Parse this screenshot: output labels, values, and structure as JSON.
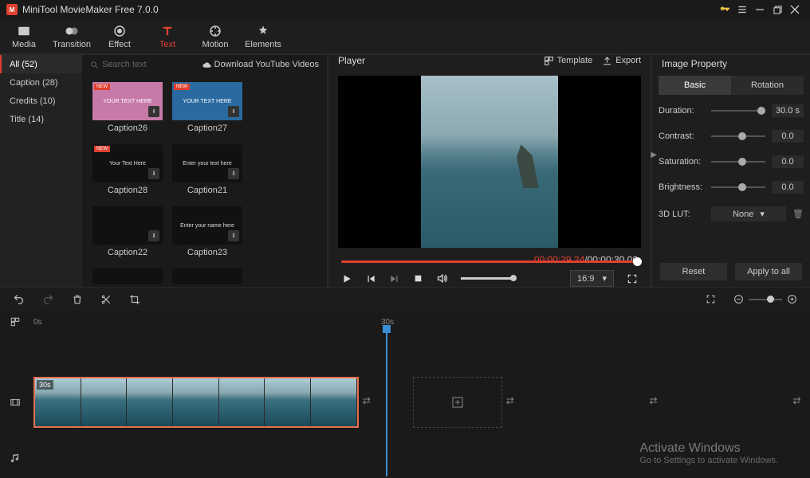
{
  "titlebar": {
    "title": "MiniTool MovieMaker Free 7.0.0"
  },
  "maintabs": {
    "media": "Media",
    "transition": "Transition",
    "effect": "Effect",
    "text": "Text",
    "motion": "Motion",
    "elements": "Elements"
  },
  "categories": [
    {
      "label": "All (52)",
      "active": true
    },
    {
      "label": "Caption (28)",
      "active": false
    },
    {
      "label": "Credits (10)",
      "active": false
    },
    {
      "label": "Title (14)",
      "active": false
    }
  ],
  "search_placeholder": "Search text",
  "download_link": "Download YouTube Videos",
  "captions": [
    {
      "name": "Caption26",
      "new": true,
      "inner": "YOUR TEXT HERE",
      "bg": "#c77aa8"
    },
    {
      "name": "Caption27",
      "new": true,
      "inner": "YOUR TEXT HERE",
      "bg": "#2a6aa0"
    },
    {
      "name": "Caption28",
      "new": true,
      "inner": "Your Text Here",
      "bg": "#111"
    },
    {
      "name": "Caption21",
      "new": false,
      "inner": "Enter your text here",
      "bg": "#111"
    },
    {
      "name": "Caption22",
      "new": false,
      "inner": "",
      "bg": "#111"
    },
    {
      "name": "Caption23",
      "new": false,
      "inner": "Enter your name here",
      "bg": "#111"
    }
  ],
  "player": {
    "title": "Player",
    "template": "Template",
    "export": "Export",
    "current": "00:00:29.24",
    "sep": " / ",
    "total": "00:00:30.00",
    "aspect": "16:9"
  },
  "props": {
    "title": "Image Property",
    "tabs": {
      "basic": "Basic",
      "rotation": "Rotation"
    },
    "duration": "Duration:",
    "duration_val": "30.0 s",
    "contrast": "Contrast:",
    "contrast_val": "0.0",
    "saturation": "Saturation:",
    "saturation_val": "0.0",
    "brightness": "Brightness:",
    "brightness_val": "0.0",
    "lut": "3D LUT:",
    "lut_val": "None",
    "reset": "Reset",
    "apply": "Apply to all"
  },
  "timeline": {
    "ruler": {
      "t0": "0s",
      "t30": "30s"
    },
    "clip_duration": "30s"
  },
  "watermark": {
    "l1": "Activate Windows",
    "l2": "Go to Settings to activate Windows."
  }
}
